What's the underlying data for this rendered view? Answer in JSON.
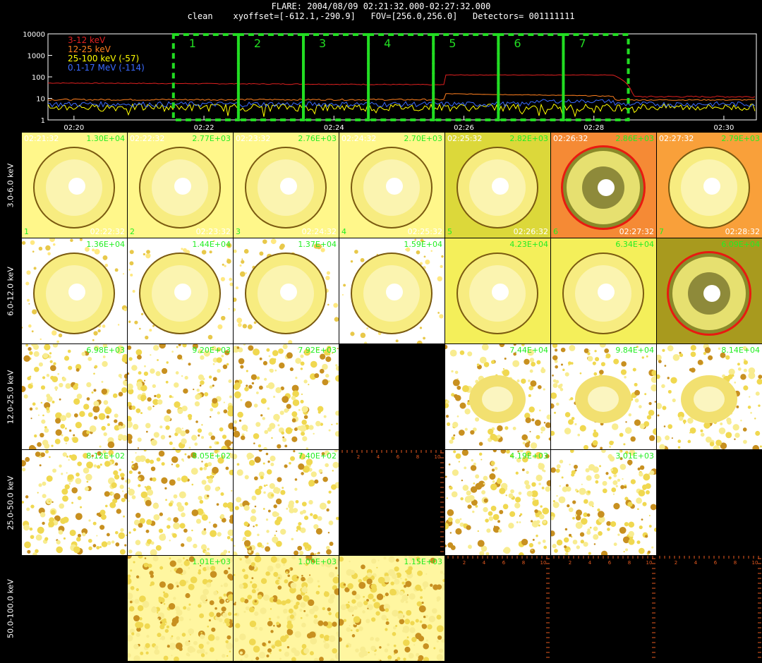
{
  "header": {
    "line1": "FLARE: 2004/08/09 02:21:32.000-02:27:32.000",
    "line2": "clean    xyoffset=[-612.1,-290.9]   FOV=[256.0,256.0]   Detectors= 001111111"
  },
  "lightcurve": {
    "y_ticks": [
      "10000",
      "1000",
      "100",
      "10",
      "1"
    ],
    "x_ticks": [
      "02:20",
      "02:22",
      "02:24",
      "02:26",
      "02:28",
      "02:30"
    ],
    "legend": [
      {
        "label": "3-12 keV",
        "color": "#e02020"
      },
      {
        "label": "12-25 keV",
        "color": "#ff7f1f"
      },
      {
        "label": "25-100 keV (-57)",
        "color": "#ffff00"
      },
      {
        "label": "0.1-17 MeV (-114)",
        "color": "#3a6aff"
      }
    ],
    "interval_labels": [
      "1",
      "2",
      "3",
      "4",
      "5",
      "6",
      "7"
    ],
    "interval_color": "#22dd22"
  },
  "rows": [
    {
      "label": "3.0-6.0 keV",
      "panels": [
        {
          "type": "disk",
          "bg": "#fff78a",
          "max": "1.30E+04",
          "tl": "02:21:32",
          "num": "1",
          "br": "02:22:32"
        },
        {
          "type": "disk",
          "bg": "#fff78a",
          "max": "2.77E+03",
          "tl": "02:22:32",
          "num": "2",
          "br": "02:23:32"
        },
        {
          "type": "disk",
          "bg": "#fff78a",
          "max": "2.76E+03",
          "tl": "02:23:32",
          "num": "3",
          "br": "02:24:32"
        },
        {
          "type": "disk",
          "bg": "#fff78a",
          "max": "2.70E+03",
          "tl": "02:24:32",
          "num": "4",
          "br": "02:25:32"
        },
        {
          "type": "disk",
          "bg": "#dcd83a",
          "max": "2.82E+03",
          "tl": "02:25:32",
          "num": "5",
          "br": "02:26:32"
        },
        {
          "type": "ring",
          "bg": "#f58a35",
          "max": "2.86E+03",
          "tl": "02:26:32",
          "num": "6",
          "br": "02:27:32"
        },
        {
          "type": "disk",
          "bg": "#f9a03a",
          "max": "2.79E+03",
          "tl": "02:27:32",
          "num": "7",
          "br": "02:28:32"
        }
      ]
    },
    {
      "label": "6.0-12.0 keV",
      "panels": [
        {
          "type": "patchy-disk",
          "bg": "#ffffff",
          "max": "1.36E+04"
        },
        {
          "type": "patchy-disk",
          "bg": "#ffffff",
          "max": "1.44E+04"
        },
        {
          "type": "patchy-disk",
          "bg": "#ffffff",
          "max": "1.37E+04"
        },
        {
          "type": "patchy-disk",
          "bg": "#ffffff",
          "max": "1.59E+04"
        },
        {
          "type": "disk",
          "bg": "#f4ef5a",
          "max": "4.23E+04"
        },
        {
          "type": "disk",
          "bg": "#f4ef5a",
          "max": "6.34E+04"
        },
        {
          "type": "ring",
          "bg": "#a89a1e",
          "max": "6.09E+04"
        }
      ]
    },
    {
      "label": "12.0-25.0 keV",
      "panels": [
        {
          "type": "noise",
          "bg": "#ffffff",
          "max": "6.98E+03"
        },
        {
          "type": "noise",
          "bg": "#ffffff",
          "max": "9.20E+03"
        },
        {
          "type": "noise",
          "bg": "#ffffff",
          "max": "7.92E+03"
        },
        {
          "type": "black"
        },
        {
          "type": "blob",
          "bg": "#ffffff",
          "max": "7.44E+04"
        },
        {
          "type": "blob",
          "bg": "#ffffff",
          "max": "9.84E+04"
        },
        {
          "type": "blob",
          "bg": "#ffffff",
          "max": "8.14E+04"
        }
      ]
    },
    {
      "label": "25.0-50.0 keV",
      "panels": [
        {
          "type": "noise",
          "bg": "#ffffff",
          "max": "8.12E+02"
        },
        {
          "type": "noise",
          "bg": "#ffffff",
          "max": "8.05E+02"
        },
        {
          "type": "noise",
          "bg": "#ffffff",
          "max": "7.40E+02"
        },
        {
          "type": "black-ticks"
        },
        {
          "type": "noise",
          "bg": "#ffffff",
          "max": "4.19E+03"
        },
        {
          "type": "noise",
          "bg": "#ffffff",
          "max": "3.01E+03"
        },
        {
          "type": "black"
        }
      ]
    },
    {
      "label": "50.0-100.0 keV",
      "panels": [
        {
          "type": "black"
        },
        {
          "type": "noise-dense",
          "bg": "#fff6a0",
          "max": "1.01E+03"
        },
        {
          "type": "noise-dense",
          "bg": "#fff6a0",
          "max": "1.00E+03"
        },
        {
          "type": "noise-dense",
          "bg": "#fff6a0",
          "max": "1.15E+03"
        },
        {
          "type": "black-ticks"
        },
        {
          "type": "black-ticks"
        },
        {
          "type": "black-ticks"
        }
      ]
    }
  ],
  "tick_labels": [
    "2",
    "4",
    "6",
    "8",
    "10"
  ]
}
